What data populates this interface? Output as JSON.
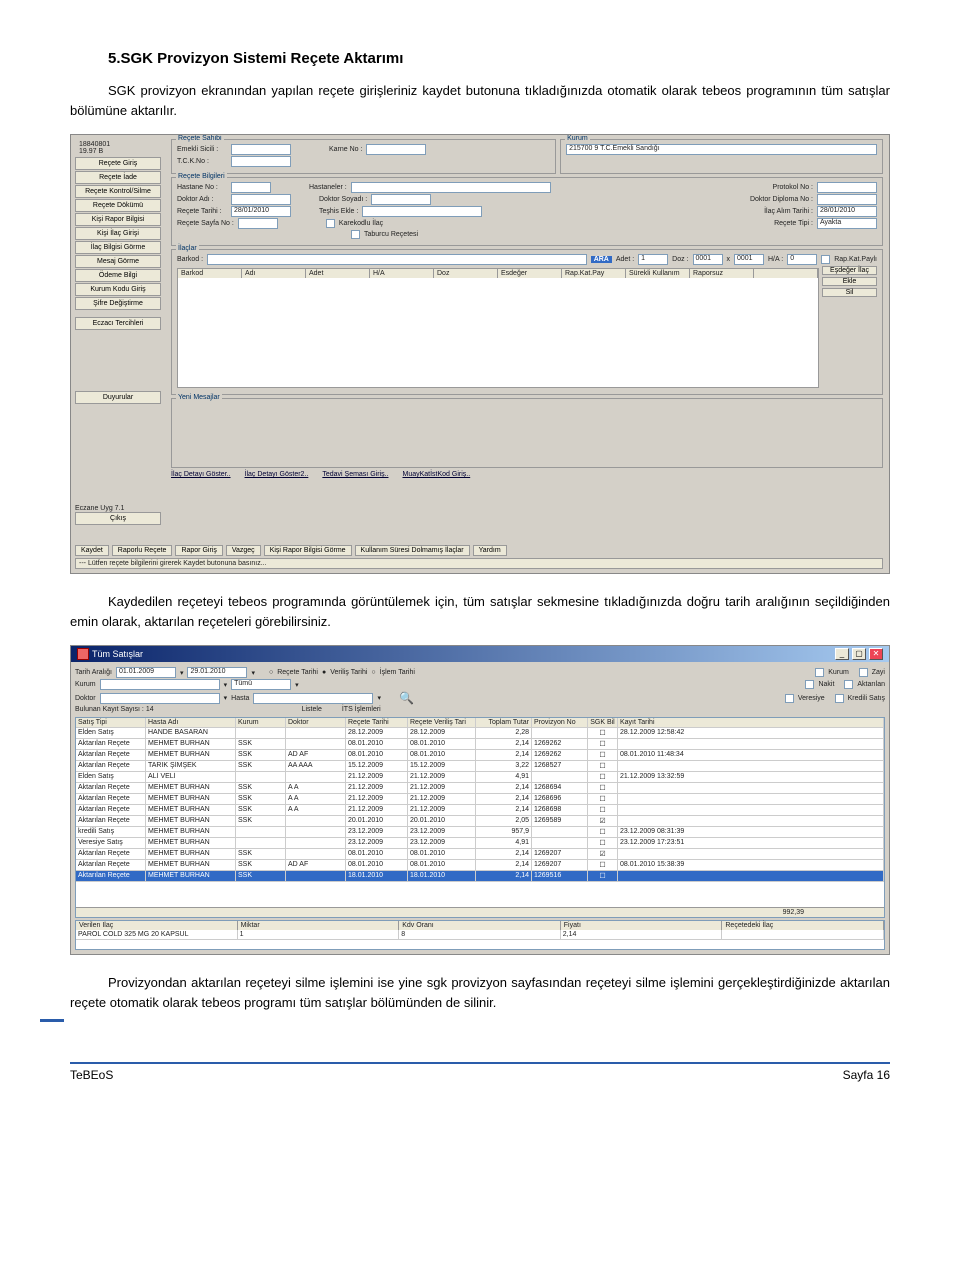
{
  "heading": "5.SGK Provizyon Sistemi Reçete Aktarımı",
  "para1": "SGK provizyon ekranından yapılan reçete girişleriniz kaydet butonuna tıkladığınızda otomatik olarak tebeos programının tüm satışlar bölümüne aktarılır.",
  "para2": "Kaydedilen reçeteyi tebeos programında görüntülemek için, tüm satışlar sekmesine tıkladığınızda doğru tarih aralığının seçildiğinden emin olarak, aktarılan reçeteleri görebilirsiniz.",
  "para3": "Provizyondan aktarılan reçeteyi silme işlemini ise yine sgk provizyon sayfasından reçeteyi silme işlemini gerçekleştirdiğinizde aktarılan reçete otomatik olarak tebeos programı tüm satışlar bölümünden de silinir.",
  "footer": {
    "left": "TeBEoS",
    "right": "Sayfa 16"
  },
  "sgk": {
    "topId": "18840801",
    "topPct": "19.97 B",
    "leftButtons": [
      "Reçete Giriş",
      "Reçete İade",
      "Reçete Kontrol/Silme",
      "Reçete Dökümü",
      "Kişi Rapor Bilgisi",
      "Kişi İlaç Girişi",
      "İlaç Bilgisi Görme",
      "Mesaj Görme",
      "Ödeme Bilgi",
      "Kurum Kodu Giriş",
      "Şifre Değiştirme"
    ],
    "leftSep": "Eczacı Tercihleri",
    "leftBot": "Duyurular",
    "leftVers": "Eczane Uyg 7.1",
    "leftCikis": "Çıkış",
    "fs1Title": "Reçete Sahibi",
    "fs1": {
      "emekli": "Emekli Sicili :",
      "karne": "Karne No :",
      "tckn": "T.C.K.No :"
    },
    "fs1b": {
      "title": "Kurum",
      "val": "215700 9 T.C.Emekli Sandığı"
    },
    "fs2Title": "Reçete Bilgileri",
    "fs2": {
      "hastane": "Hastane No :",
      "hastaneler": "Hastaneler :",
      "protokol": "Protokol No :",
      "doktor": "Doktor Adı :",
      "soyad": "Doktor Soyadı :",
      "diploma": "Doktor Diploma No :",
      "rtarih": "Reçete Tarihi :",
      "rtval": "28/01/2010",
      "teshis": "Teşhis Ekle :",
      "iat": "İlaç Alım Tarihi :",
      "iatval": "28/01/2010",
      "rsayfa": "Reçete Sayfa No :",
      "kare": "Karekodlu İlaç",
      "rtip": "Reçete Tipi :",
      "rtipval": "Ayakta",
      "taburcu": "Taburcu Reçetesi"
    },
    "fs3Title": "İlaçlar",
    "fs3": {
      "barkod": "Barkod :",
      "ara": "ARA",
      "adet": "Adet :",
      "adetv": "1",
      "doz": "Doz :",
      "doz1": "0001",
      "x": "x",
      "doz2": "0001",
      "ha": "H/A :",
      "hav": "0",
      "rkp": "Rap.Kat.Paylı"
    },
    "gridCols": [
      "Barkod",
      "Adı",
      "Adet",
      "H/A",
      "Doz",
      "Esdeğer",
      "Rap.Kat.Pay",
      "Sürekli Kullanım",
      "Raporsuz",
      ""
    ],
    "rightBtns": [
      "Eşdeğer İlaç",
      "Ekle",
      "Sil"
    ],
    "msgTitle": "Yeni Mesajlar",
    "botLeft": [
      "İlaç Detayı Göster..",
      "İlaç Detayı Göster2..",
      "Tedavi Şeması Giriş..",
      "MuayKatİstKod Giriş.."
    ],
    "botBtns": [
      "Kaydet",
      "Raporlu Reçete",
      "Rapor Giriş",
      "Vazgeç",
      "Kişi Rapor Bilgisi Görme",
      "Kullanım Süresi Dolmamış İlaçlar",
      "Yardım"
    ],
    "statusMsg": "--- Lütfen reçete bilgilerini girerek Kaydet butonuna basınız..."
  },
  "tum": {
    "winTitle": "Tüm Satışlar",
    "labels": {
      "tarih": "Tarih Aralığı",
      "d1": "01.01.2009",
      "d2": "29.01.2010",
      "rt": "Reçete Tarihi",
      "vt": "Veriliş Tarihi",
      "it": "İşlem Tarihi",
      "kurum": "Kurum",
      "kurumicin": "Tümü",
      "doktor": "Doktor",
      "hasta": "Hasta",
      "bulunan": "Bulunan Kayıt Sayısı : 14",
      "listele": "Listele",
      "its": "İTS İşlemleri",
      "ckKurum": "Kurum",
      "ckNakit": "Nakit",
      "ckVeresiye": "Veresiye",
      "ckZayi": "Zayi",
      "ckAkt": "Aktarılan",
      "ckKredi": "Kredili Satış"
    },
    "cols": [
      "Satış Tipi",
      "Hasta Adı",
      "Kurum",
      "Doktor",
      "Reçete Tarihi",
      "Reçete Veriliş Tari",
      "Toplam Tutar",
      "Provizyon No",
      "SGK Bil",
      "Kayıt Tarihi"
    ],
    "rows": [
      [
        "Elden Satış",
        "HANDE BASARAN",
        "",
        "",
        "28.12.2009",
        "28.12.2009",
        "2,28",
        "",
        "☐",
        "28.12.2009 12:58:42"
      ],
      [
        "Aktarılan Reçete",
        "MEHMET BURHAN",
        "SSK",
        "",
        "08.01.2010",
        "08.01.2010",
        "2,14",
        "1269262",
        "☐",
        ""
      ],
      [
        "Aktarılan Reçete",
        "MEHMET BURHAN",
        "SSK",
        "AD AF",
        "08.01.2010",
        "08.01.2010",
        "2,14",
        "1269262",
        "☐",
        "08.01.2010 11:48:34"
      ],
      [
        "Aktarılan Reçete",
        "TARIK ŞİMŞEK",
        "SSK",
        "AA AAA",
        "15.12.2009",
        "15.12.2009",
        "3,22",
        "1268527",
        "☐",
        ""
      ],
      [
        "Elden Satış",
        "ALİ VELİ",
        "",
        "",
        "21.12.2009",
        "21.12.2009",
        "4,91",
        "",
        "☐",
        "21.12.2009 13:32:59"
      ],
      [
        "Aktarılan Reçete",
        "MEHMET BURHAN",
        "SSK",
        "A A",
        "21.12.2009",
        "21.12.2009",
        "2,14",
        "1268694",
        "☐",
        ""
      ],
      [
        "Aktarılan Reçete",
        "MEHMET BURHAN",
        "SSK",
        "A A",
        "21.12.2009",
        "21.12.2009",
        "2,14",
        "1268696",
        "☐",
        ""
      ],
      [
        "Aktarılan Reçete",
        "MEHMET BURHAN",
        "SSK",
        "A A",
        "21.12.2009",
        "21.12.2009",
        "2,14",
        "1268698",
        "☐",
        ""
      ],
      [
        "Aktarılan Reçete",
        "MEHMET BURHAN",
        "SSK",
        "",
        "20.01.2010",
        "20.01.2010",
        "2,05",
        "1269589",
        "☑",
        ""
      ],
      [
        "kredili Satış",
        "MEHMET BURHAN",
        "",
        "",
        "23.12.2009",
        "23.12.2009",
        "957,9",
        "",
        "☐",
        "23.12.2009 08:31:39"
      ],
      [
        "Veresiye Satış",
        "MEHMET BURHAN",
        "",
        "",
        "23.12.2009",
        "23.12.2009",
        "4,91",
        "",
        "☐",
        "23.12.2009 17:23:51"
      ],
      [
        "Aktarılan Reçete",
        "MEHMET BURHAN",
        "SSK",
        "",
        "08.01.2010",
        "08.01.2010",
        "2,14",
        "1269207",
        "☑",
        ""
      ],
      [
        "Aktarılan Reçete",
        "MEHMET BURHAN",
        "SSK",
        "AD AF",
        "08.01.2010",
        "08.01.2010",
        "2,14",
        "1269207",
        "☐",
        "08.01.2010 15:38:39"
      ],
      [
        "Aktarılan Reçete",
        "MEHMET BURHAN",
        "SSK",
        "",
        "18.01.2010",
        "18.01.2010",
        "2,14",
        "1269516",
        "☐",
        ""
      ]
    ],
    "total": "992,39",
    "subCols": [
      "Verilen Ilaç",
      "Miktar",
      "Kdv Oranı",
      "Fiyatı",
      "Reçetedeki İlaç"
    ],
    "subRow": [
      "PAROL COLD 325 MG 20 KAPSUL",
      "1",
      "8",
      "2,14",
      ""
    ]
  }
}
